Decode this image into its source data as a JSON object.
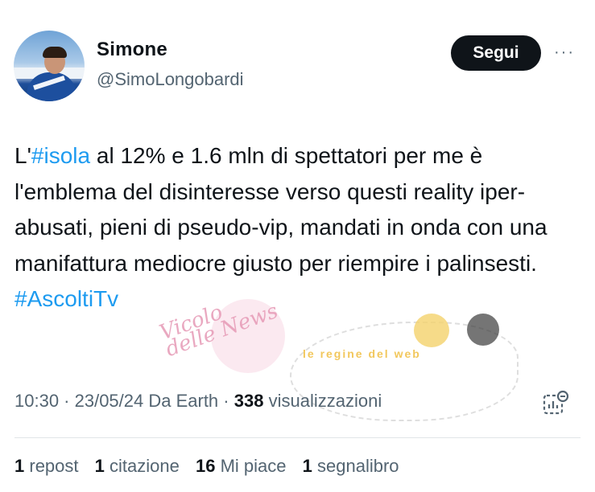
{
  "user": {
    "name": "Simone",
    "handle": "@SimoLongobardi"
  },
  "follow_label": "Segui",
  "more_label": "···",
  "tweet": {
    "prefix": "L'",
    "hashtag1": "#isola",
    "body": " al 12% e 1.6 mln di spettatori per me è l'emblema del disinteresse verso questi reality iper-abusati, pieni di pseudo-vip, mandati in onda con una manifattura mediocre giusto per riempire i palinsesti.",
    "hashtag2": "#AscoltiTv"
  },
  "meta": {
    "time_date": "10:30 · 23/05/24 Da Earth ·",
    "views": "338",
    "views_label": "visualizzazioni"
  },
  "stats": {
    "reposts": "1",
    "reposts_label": "repost",
    "quotes": "1",
    "quotes_label": "citazione",
    "likes": "16",
    "likes_label": "Mi piace",
    "bookmarks": "1",
    "bookmarks_label": "segnalibro"
  },
  "watermark": {
    "left": "Vicolo delle News",
    "right": "le regine del web"
  },
  "colors": {
    "link": "#1d9bf0",
    "secondary": "#536471",
    "primary": "#0f1419"
  }
}
